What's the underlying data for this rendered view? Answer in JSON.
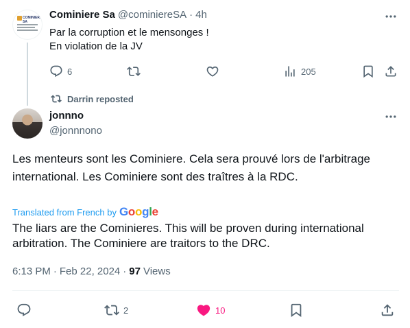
{
  "reply_tweet": {
    "author_name": "Cominiere Sa",
    "author_handle": "@cominiereSA",
    "dot": "·",
    "time": "4h",
    "text_lines": [
      "Par la corruption et le mensonges !",
      "En violation de la JV"
    ],
    "avatar_logo_text": "COMINIERE SA",
    "actions": {
      "reply_count": "6",
      "views_count": "205"
    }
  },
  "repost": {
    "label": "Darrin reposted"
  },
  "main_tweet": {
    "author_name": "jonnno",
    "author_handle": "@jonnnono",
    "text": "Les menteurs sont les Cominiere. Cela sera prouvé lors de l'arbitrage international. Les Cominiere sont des traîtres à la RDC.",
    "translated_label": "Translated from French by",
    "translator": "Google",
    "translation": "The liars are the Cominieres. This will be proven during international arbitration. The Cominiere are traitors to the DRC.",
    "time": "6:13 PM",
    "sep": "·",
    "date": "Feb 22, 2024",
    "views_count": "97",
    "views_label": "Views",
    "actions": {
      "retweet_count": "2",
      "like_count": "10",
      "like_color": "#f91880"
    }
  },
  "colors": {
    "text_primary": "#0f1419",
    "text_secondary": "#536471",
    "link_blue": "#1d9bf0",
    "like_pink": "#f91880"
  },
  "icons": [
    "reply-icon",
    "retweet-icon",
    "like-icon",
    "views-icon",
    "bookmark-icon",
    "share-icon",
    "more-icon",
    "repost-icon"
  ]
}
